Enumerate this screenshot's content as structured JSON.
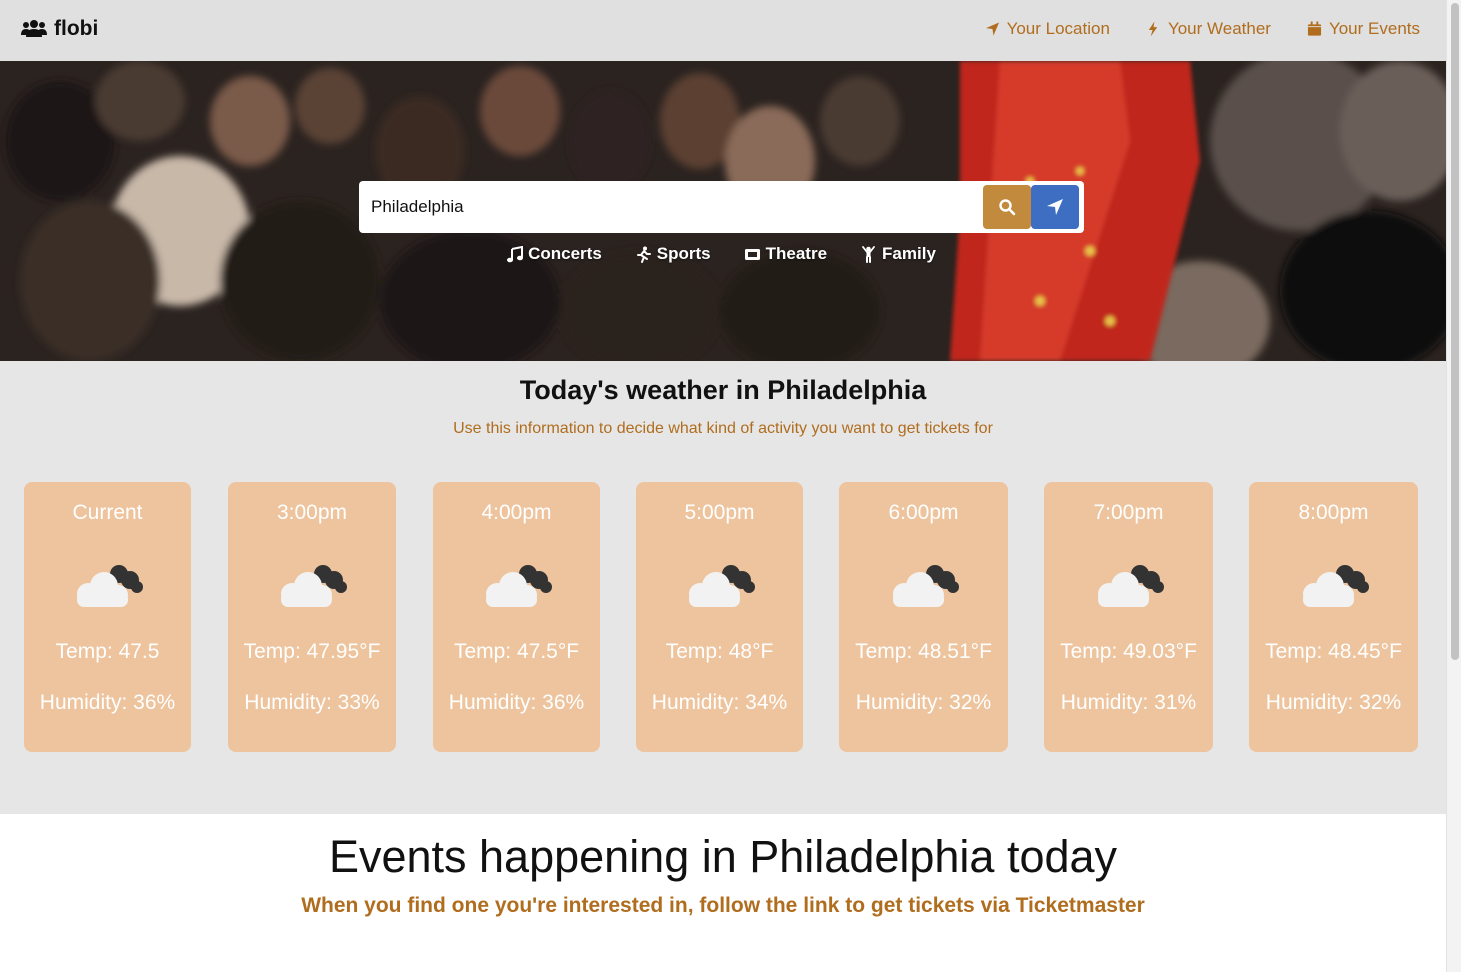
{
  "nav": {
    "brand": "flobi",
    "links": [
      {
        "label": "Your Location",
        "icon": "location-arrow-icon"
      },
      {
        "label": "Your Weather",
        "icon": "bolt-icon"
      },
      {
        "label": "Your Events",
        "icon": "calendar-icon"
      }
    ]
  },
  "search": {
    "value": "Philadelphia",
    "search_icon": "search-icon",
    "locate_icon": "location-arrow-icon"
  },
  "categories": [
    {
      "label": "Concerts",
      "icon": "music-icon"
    },
    {
      "label": "Sports",
      "icon": "running-icon"
    },
    {
      "label": "Theatre",
      "icon": "ticket-icon"
    },
    {
      "label": "Family",
      "icon": "child-icon"
    }
  ],
  "weather": {
    "title": "Today's weather in Philadelphia",
    "subtitle": "Use this information to decide what kind of activity you want to get tickets for",
    "cards": [
      {
        "time": "Current",
        "temp": "Temp: 47.5",
        "humidity": "Humidity: 36%",
        "icon": "cloudy-icon"
      },
      {
        "time": "3:00pm",
        "temp": "Temp: 47.95°F",
        "humidity": "Humidity: 33%",
        "icon": "cloudy-icon"
      },
      {
        "time": "4:00pm",
        "temp": "Temp: 47.5°F",
        "humidity": "Humidity: 36%",
        "icon": "cloudy-icon"
      },
      {
        "time": "5:00pm",
        "temp": "Temp: 48°F",
        "humidity": "Humidity: 34%",
        "icon": "cloudy-icon"
      },
      {
        "time": "6:00pm",
        "temp": "Temp: 48.51°F",
        "humidity": "Humidity: 32%",
        "icon": "cloudy-icon"
      },
      {
        "time": "7:00pm",
        "temp": "Temp: 49.03°F",
        "humidity": "Humidity: 31%",
        "icon": "cloudy-icon"
      },
      {
        "time": "8:00pm",
        "temp": "Temp: 48.45°F",
        "humidity": "Humidity: 32%",
        "icon": "cloudy-icon"
      }
    ]
  },
  "events": {
    "title": "Events happening in Philadelphia today",
    "subtitle": "When you find one you're interested in, follow the link to get tickets via Ticketmaster"
  },
  "colors": {
    "accent": "#b06d1e",
    "card_bg": "#edc49d",
    "search_button": "#c28a3d",
    "locate_button": "#3d6ec2",
    "navbar_bg": "#e0e0e0",
    "weather_bg": "#e6e6e6"
  }
}
